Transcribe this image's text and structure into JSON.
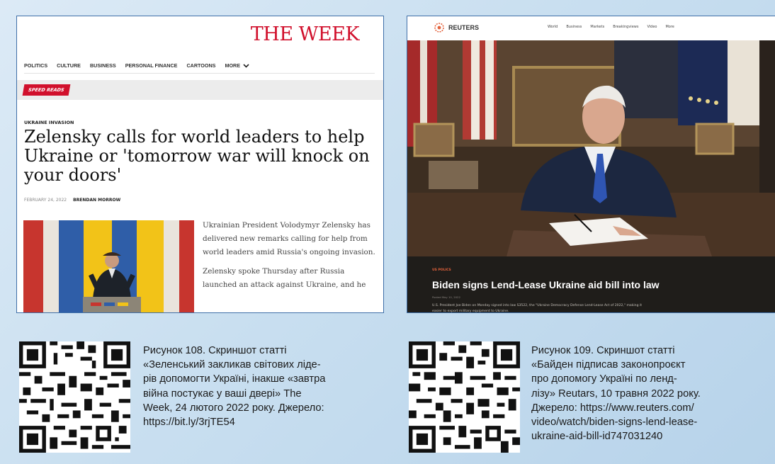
{
  "week": {
    "logo": "THE WEEK",
    "nav": [
      "POLITICS",
      "CULTURE",
      "BUSINESS",
      "PERSONAL FINANCE",
      "CARTOONS",
      "MORE"
    ],
    "badge": "SPEED READS",
    "kicker": "UKRAINE INVASION",
    "headline": "Zelensky calls for world leaders to help Ukraine or 'tomorrow war will knock on your doors'",
    "date": "FEBRUARY 24, 2022",
    "author": "BRENDAN MORROW",
    "body": [
      "Ukrainian President Volodymyr Zelensky has delivered new remarks calling for help from world leaders amid Russia's ongoing invasion.",
      "Zelensky spoke Thursday after Russia launched an attack against Ukraine, and he"
    ]
  },
  "reuters": {
    "logo": "REUTERS",
    "nav": [
      "World",
      "Business",
      "Markets",
      "Breakingviews",
      "Video",
      "More"
    ],
    "kicker": "US POLICS",
    "title": "Biden signs Lend-Lease Ukraine aid bill into law",
    "date": "Posted May 10, 2022",
    "desc": "U.S. President Joe Biden on Monday signed into law S3522, the \"Ukraine Democracy Defense Lend-Lease Act of 2022,\" making it easier to export military equipment to Ukraine."
  },
  "captions": {
    "fig108": [
      "Рисунок 108. Скриншот статті",
      "«Зеленський закликав світових ліде-",
      "рів допомогти Україні, інакше «завтра",
      "війна постукає у ваші двері» The",
      "Week, 24 лютого 2022 року. Джерело:",
      "https://bit.ly/3rjTE54"
    ],
    "fig109": [
      "Рисунок 109. Скриншот статті",
      "«Байден підписав законопроєкт",
      "про допомогу Україні по ленд-",
      "лізу» Reutars, 10 травня 2022 року.",
      "Джерело: https://www.reuters.com/",
      "video/watch/biden-signs-lend-lease-",
      "ukraine-aid-bill-id747031240"
    ]
  },
  "colors": {
    "week_red": "#d1102c",
    "reuters_orange": "#e3623c",
    "frame_blue": "#3f6fa8"
  }
}
